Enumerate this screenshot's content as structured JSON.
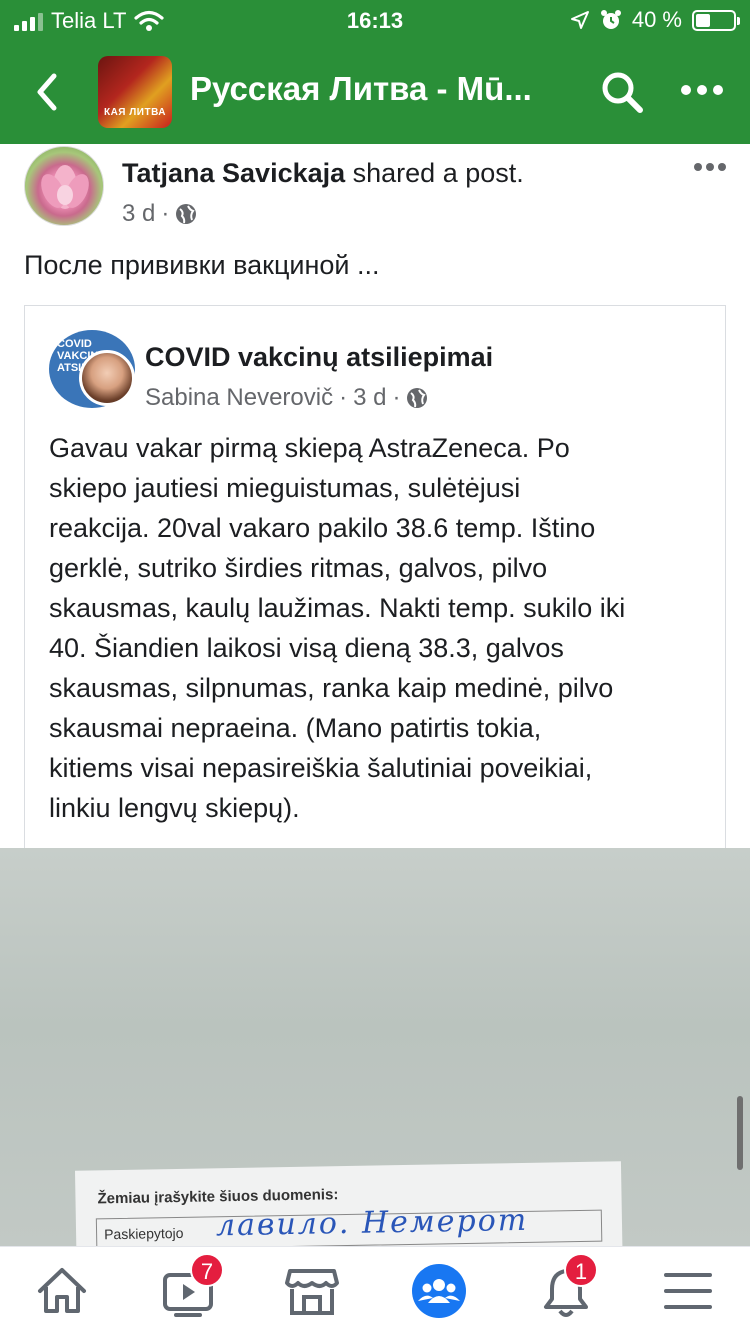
{
  "status_bar": {
    "carrier": "Telia LT",
    "time": "16:13",
    "battery_text": "40 %",
    "battery_level": 0.4
  },
  "header": {
    "group_thumb_text": "КАЯ ЛИТВА",
    "title": "Русская Литва - Mū...",
    "icons": [
      "back-arrow-icon",
      "search-icon",
      "more-icon"
    ]
  },
  "post": {
    "author": "Tatjana Savickaja",
    "action": " shared a post.",
    "time": "3 d",
    "privacy_icon": "globe-icon",
    "text": "После прививки вакциной ..."
  },
  "shared_post": {
    "group_thumb_text": "COVID VAKCINŲ ATSILIEPIMAI",
    "group_name": "COVID vakcinų atsiliepimai",
    "author": "Sabina Neverovič",
    "time": "3 d",
    "privacy_icon": "globe-icon",
    "body": "Gavau vakar pirmą skiepą AstraZeneca. Po\nskiepo jautiesi mieguistumas, sulėtėjusi\nreakcija. 20val vakaro pakilo 38.6 temp. Ištino\ngerklė, sutriko širdies ritmas, galvos, pilvo\nskausmas, kaulų laužimas. Nakti temp. sukilo iki\n40. Šiandien laikosi visą dieną 38.3, galvos\nskausmas, silpnumas, ranka kaip medinė, pilvo\nskausmai nepraeina. (Mano patirtis tokia,\nkitiems visai nepasireiškia šalutiniai poveikiai,\nlinkiu lengvų skiepų)."
  },
  "photo": {
    "paper_heading": "Žemiau įrašykite šiuos duomenis:",
    "paper_field": "Paskiepytojo",
    "signature": "лавило. Немерот"
  },
  "bottom_nav": {
    "items": [
      "home-icon",
      "watch-icon",
      "marketplace-icon",
      "groups-icon",
      "notifications-icon",
      "menu-icon"
    ],
    "watch_badge": "7",
    "notifications_badge": "1",
    "active_color": "#1877f2"
  }
}
